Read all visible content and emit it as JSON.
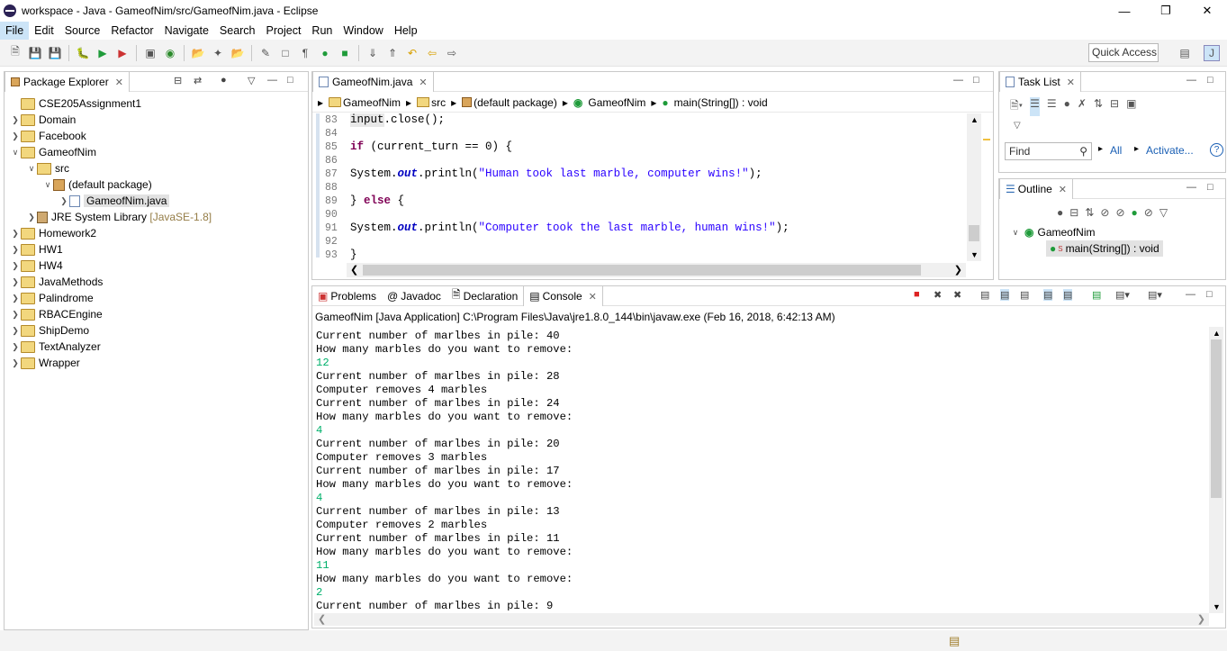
{
  "window": {
    "title": "workspace - Java - GameofNim/src/GameofNim.java - Eclipse"
  },
  "menu": [
    "File",
    "Edit",
    "Source",
    "Refactor",
    "Navigate",
    "Search",
    "Project",
    "Run",
    "Window",
    "Help"
  ],
  "quick_access": "Quick Access",
  "package_explorer": {
    "tab": "Package Explorer",
    "items": [
      {
        "label": "CSE205Assignment1"
      },
      {
        "label": "Domain"
      },
      {
        "label": "Facebook"
      },
      {
        "label": "GameofNim"
      },
      {
        "label": "src"
      },
      {
        "label": "(default package)"
      },
      {
        "label": "GameofNim.java"
      },
      {
        "label": "JRE System Library",
        "extra": "[JavaSE-1.8]"
      },
      {
        "label": "Homework2"
      },
      {
        "label": "HW1"
      },
      {
        "label": "HW4"
      },
      {
        "label": "JavaMethods"
      },
      {
        "label": "Palindrome"
      },
      {
        "label": "RBACEngine"
      },
      {
        "label": "ShipDemo"
      },
      {
        "label": "TextAnalyzer"
      },
      {
        "label": "Wrapper"
      }
    ]
  },
  "editor": {
    "tab": "GameofNim.java",
    "breadcrumb": [
      "GameofNim",
      "src",
      "(default package)",
      "GameofNim",
      "main(String[]) : void"
    ],
    "lines": [
      "83",
      "84",
      "85",
      "86",
      "87",
      "88",
      "89",
      "90",
      "91",
      "92",
      "93"
    ],
    "code": {
      "l83a": "input",
      "l83b": ".close();",
      "l85a": "if",
      "l85b": " (current_turn == 0) {",
      "l87a": "System.",
      "l87b": "out",
      "l87c": ".println(",
      "l87d": "\"Human took last marble, computer wins!\"",
      "l87e": ");",
      "l89a": "} ",
      "l89b": "else",
      "l89c": " {",
      "l91a": "System.",
      "l91b": "out",
      "l91c": ".println(",
      "l91d": "\"Computer took the last marble, human wins!\"",
      "l91e": ");",
      "l93": "}"
    }
  },
  "task_list": {
    "tab": "Task List",
    "find_placeholder": "Find",
    "all": "All",
    "activate": "Activate..."
  },
  "outline": {
    "tab": "Outline",
    "class": "GameofNim",
    "method": "main(String[]) : void",
    "static_marker": "S"
  },
  "bottom_tabs": [
    "Problems",
    "Javadoc",
    "Declaration",
    "Console"
  ],
  "console": {
    "header": "GameofNim [Java Application] C:\\Program Files\\Java\\jre1.8.0_144\\bin\\javaw.exe (Feb 16, 2018, 6:42:13 AM)",
    "lines": [
      {
        "text": "Current number of marlbes in pile: 40",
        "input": false
      },
      {
        "text": "How many marbles do you want to remove:",
        "input": false
      },
      {
        "text": "12",
        "input": true
      },
      {
        "text": "Current number of marlbes in pile: 28",
        "input": false
      },
      {
        "text": "Computer removes 4 marbles",
        "input": false
      },
      {
        "text": "Current number of marlbes in pile: 24",
        "input": false
      },
      {
        "text": "How many marbles do you want to remove:",
        "input": false
      },
      {
        "text": "4",
        "input": true
      },
      {
        "text": "Current number of marlbes in pile: 20",
        "input": false
      },
      {
        "text": "Computer removes 3 marbles",
        "input": false
      },
      {
        "text": "Current number of marlbes in pile: 17",
        "input": false
      },
      {
        "text": "How many marbles do you want to remove:",
        "input": false
      },
      {
        "text": "4",
        "input": true
      },
      {
        "text": "Current number of marlbes in pile: 13",
        "input": false
      },
      {
        "text": "Computer removes 2 marbles",
        "input": false
      },
      {
        "text": "Current number of marlbes in pile: 11",
        "input": false
      },
      {
        "text": "How many marbles do you want to remove:",
        "input": false
      },
      {
        "text": "11",
        "input": true
      },
      {
        "text": "How many marbles do you want to remove:",
        "input": false
      },
      {
        "text": "2",
        "input": true
      },
      {
        "text": "Current number of marlbes in pile: 9",
        "input": false
      }
    ]
  },
  "colors": {
    "keyword": "#7f0055",
    "string": "#2a00ff",
    "field": "#0000c0",
    "console_input": "#00b06b",
    "selection": "#cce4f7"
  }
}
